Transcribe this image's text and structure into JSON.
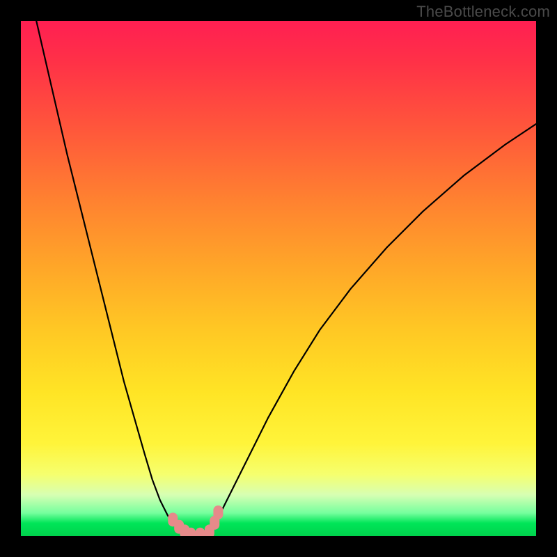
{
  "watermark": "TheBottleneck.com",
  "colors": {
    "background": "#000000",
    "gradient_top": "#ff1f52",
    "gradient_mid": "#ffc824",
    "gradient_bottom": "#00d24c",
    "curve_stroke": "#000000",
    "marker_fill": "#e68a8a"
  },
  "chart_data": {
    "type": "line",
    "title": "",
    "xlabel": "",
    "ylabel": "",
    "x_range": [
      0,
      100
    ],
    "y_range": [
      0,
      100
    ],
    "note": "No axis ticks or numeric labels are rendered in the source image; values are normalized 0–100. y=0 is the bottom (green) and y=100 is the top (red).",
    "series": [
      {
        "name": "left-curve",
        "x": [
          3,
          6,
          9,
          12,
          15,
          18,
          20,
          22,
          24,
          25.5,
          27,
          28.5,
          30,
          31,
          32,
          33
        ],
        "y": [
          100,
          87,
          74,
          62,
          50,
          38,
          30,
          23,
          16,
          11,
          7,
          4,
          2,
          1,
          0.4,
          0
        ]
      },
      {
        "name": "right-curve",
        "x": [
          36,
          37.5,
          39,
          41,
          44,
          48,
          53,
          58,
          64,
          71,
          78,
          86,
          94,
          100
        ],
        "y": [
          0,
          2,
          5,
          9,
          15,
          23,
          32,
          40,
          48,
          56,
          63,
          70,
          76,
          80
        ]
      }
    ],
    "markers": {
      "name": "highlight-points",
      "x": [
        29.5,
        30.7,
        31.8,
        33.0,
        34.8,
        36.6,
        37.6,
        38.3
      ],
      "y": [
        3.2,
        1.8,
        0.9,
        0.3,
        0.3,
        0.9,
        2.6,
        4.6
      ]
    }
  }
}
